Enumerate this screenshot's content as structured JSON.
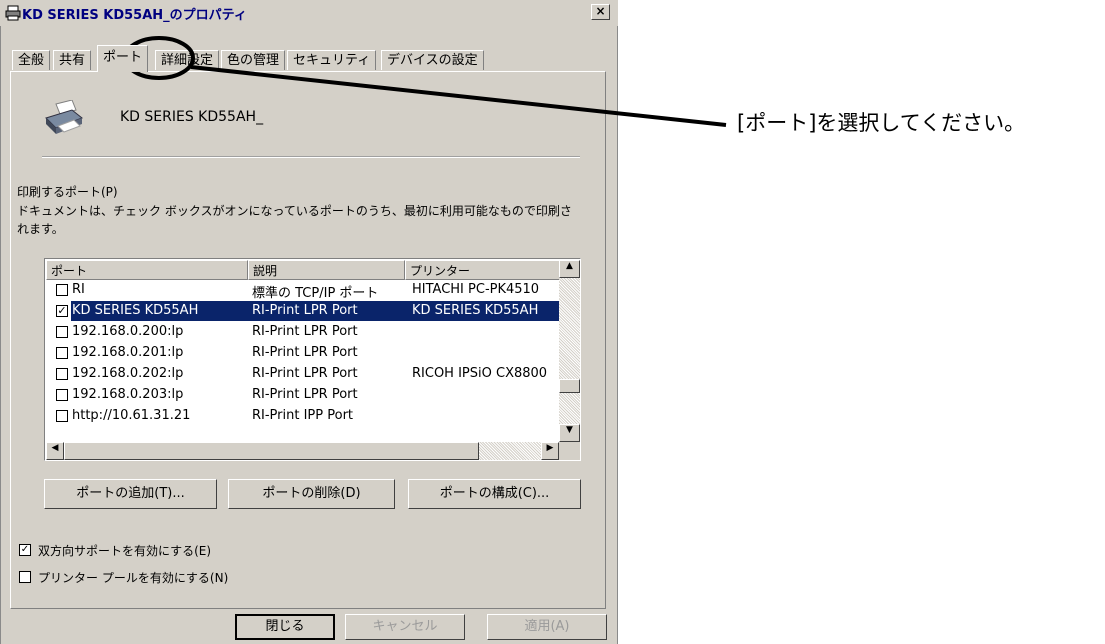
{
  "window": {
    "title": "KD SERIES KD55AH_のプロパティ",
    "close_label": "×"
  },
  "tabs": [
    {
      "label": "全般",
      "active": false
    },
    {
      "label": "共有",
      "active": false
    },
    {
      "label": "ポート",
      "active": true
    },
    {
      "label": "詳細設定",
      "active": false
    },
    {
      "label": "色の管理",
      "active": false
    },
    {
      "label": "セキュリティ",
      "active": false
    },
    {
      "label": "デバイスの設定",
      "active": false
    }
  ],
  "printer_name": "KD SERIES KD55AH_",
  "ports_section": {
    "label": "印刷するポート(P)",
    "description": "ドキュメントは、チェック ボックスがオンになっているポートのうち、最初に利用可能なもので印刷されます。"
  },
  "port_list": {
    "columns": [
      "ポート",
      "説明",
      "プリンター"
    ],
    "rows": [
      {
        "checked": false,
        "port": "RI",
        "desc": "標準の TCP/IP ポート",
        "printer": "HITACHI PC-PK4510",
        "selected": false
      },
      {
        "checked": true,
        "port": "KD SERIES KD55AH",
        "desc": "RI-Print LPR Port",
        "printer": "KD SERIES KD55AH",
        "selected": true
      },
      {
        "checked": false,
        "port": "192.168.0.200:lp",
        "desc": "RI-Print LPR Port",
        "printer": "",
        "selected": false
      },
      {
        "checked": false,
        "port": "192.168.0.201:lp",
        "desc": "RI-Print LPR Port",
        "printer": "",
        "selected": false
      },
      {
        "checked": false,
        "port": "192.168.0.202:lp",
        "desc": "RI-Print LPR Port",
        "printer": "RICOH IPSiO CX8800",
        "selected": false
      },
      {
        "checked": false,
        "port": "192.168.0.203:lp",
        "desc": "RI-Print LPR Port",
        "printer": "",
        "selected": false
      },
      {
        "checked": false,
        "port": "http://10.61.31.21",
        "desc": "RI-Print IPP Port",
        "printer": "",
        "selected": false
      }
    ]
  },
  "port_buttons": {
    "add": "ポートの追加(T)...",
    "delete": "ポートの削除(D)",
    "configure": "ポートの構成(C)..."
  },
  "options": {
    "bidirectional": {
      "label": "双方向サポートを有効にする(E)",
      "checked": true
    },
    "pooling": {
      "label": "プリンター プールを有効にする(N)",
      "checked": false
    }
  },
  "dialog_buttons": {
    "close": "閉じる",
    "cancel": "キャンセル",
    "apply": "適用(A)"
  },
  "annotation": "[ポート]を選択してください。"
}
